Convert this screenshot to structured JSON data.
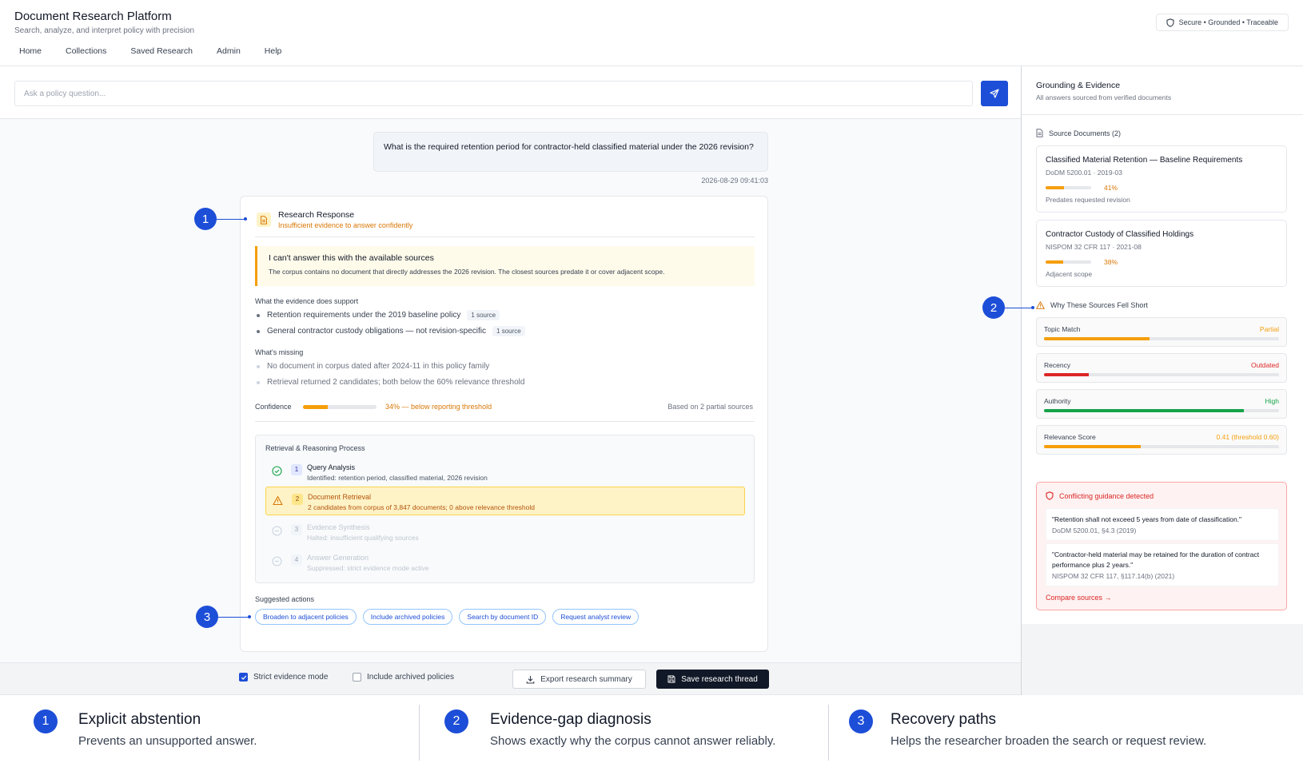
{
  "app": {
    "title": "Document Research Platform",
    "subtitle": "Search, analyze, and interpret policy with precision",
    "badge": "Secure • Grounded • Traceable"
  },
  "nav": [
    "Home",
    "Collections",
    "Saved Research",
    "Admin",
    "Help"
  ],
  "search": {
    "placeholder": "Ask a policy question...",
    "value": ""
  },
  "question": {
    "text": "What is the required retention period for contractor-held classified material under the 2026 revision?",
    "timestamp": "2026-08-29 09:41:03"
  },
  "response": {
    "title": "Research Response",
    "status": "Insufficient evidence to answer confidently",
    "abstain_title": "I can't answer this with the available sources",
    "abstain_body": "The corpus contains no document that directly addresses the 2026 revision. The closest sources predate it or cover adjacent scope.",
    "supports_label": "What the evidence does support",
    "supports": [
      {
        "text": "Retention requirements under the 2019 baseline policy",
        "chip": "1 source"
      },
      {
        "text": "General contractor custody obligations — not revision-specific",
        "chip": "1 source"
      }
    ],
    "missing_label": "What's missing",
    "missing": [
      "No document in corpus dated after 2024-11 in this policy family",
      "Retrieval returned 2 candidates; both below the 60% relevance threshold"
    ],
    "confidence_label": "Confidence",
    "confidence_value": 0.34,
    "confidence_text": "34% — below reporting threshold",
    "confidence_basis": "Based on 2 partial sources",
    "process_title": "Retrieval & Reasoning Process",
    "steps": [
      {
        "num": "1",
        "title": "Query Analysis",
        "desc": "Identified: retention period, classified material, 2026 revision",
        "state": "done"
      },
      {
        "num": "2",
        "title": "Document Retrieval",
        "desc": "2 candidates from corpus of 3,847 documents; 0 above relevance threshold",
        "state": "warn"
      },
      {
        "num": "3",
        "title": "Evidence Synthesis",
        "desc": "Halted: insufficient qualifying sources",
        "state": "dim"
      },
      {
        "num": "4",
        "title": "Answer Generation",
        "desc": "Suppressed: strict evidence mode active",
        "state": "dim"
      }
    ],
    "suggested_label": "Suggested actions",
    "suggested": [
      "Broaden to adjacent policies",
      "Include archived policies",
      "Search by document ID",
      "Request analyst review"
    ]
  },
  "footer": {
    "strict_mode": "Strict evidence mode",
    "strict_checked": true,
    "include_archived": "Include archived policies",
    "archived_checked": false,
    "export": "Export research summary",
    "save": "Save research thread"
  },
  "panel": {
    "title": "Grounding & Evidence",
    "subtitle": "All answers sourced from verified documents",
    "sources_label": "Source Documents (2)",
    "sources": [
      {
        "title": "Classified Material Retention — Baseline Requirements",
        "meta": "DoDM 5200.01 · 2019-03",
        "relevance": 0.41,
        "pct": "41%",
        "note": "Predates requested revision"
      },
      {
        "title": "Contractor Custody of Classified Holdings",
        "meta": "NISPOM 32 CFR 117 · 2021-08",
        "relevance": 0.38,
        "pct": "38%",
        "note": "Adjacent scope"
      }
    ],
    "why_label": "Why These Sources Fell Short",
    "metrics": [
      {
        "name": "Topic Match",
        "value": "Partial",
        "level": 0.45,
        "color": "#f59e0b"
      },
      {
        "name": "Recency",
        "value": "Outdated",
        "level": 0.19,
        "color": "#dc2626"
      },
      {
        "name": "Authority",
        "value": "High",
        "level": 0.85,
        "color": "#16a34a"
      },
      {
        "name": "Relevance Score",
        "value": "0.41 (threshold 0.60)",
        "level": 0.41,
        "color": "#f59e0b"
      }
    ],
    "conflict_title": "Conflicting guidance detected",
    "quotes": [
      {
        "text": "\"Retention shall not exceed 5 years from date of classification.\"",
        "source": "DoDM 5200.01, §4.3 (2019)"
      },
      {
        "text": "\"Contractor-held material may be retained for the duration of contract performance plus 2 years.\"",
        "source": "NISPOM 32 CFR 117, §117.14(b) (2021)"
      }
    ],
    "compare": "Compare sources →"
  },
  "callouts": [
    "1",
    "2",
    "3"
  ],
  "legend": [
    {
      "num": "1",
      "title": "Explicit abstention",
      "desc": "Prevents an unsupported answer."
    },
    {
      "num": "2",
      "title": "Evidence-gap diagnosis",
      "desc": "Shows exactly why the corpus cannot answer reliably."
    },
    {
      "num": "3",
      "title": "Recovery paths",
      "desc": "Helps the researcher broaden the search or request review."
    }
  ],
  "colors": {
    "accent": "#1d4ed8",
    "warning": "#f59e0b",
    "danger": "#dc2626",
    "success": "#16a34a"
  }
}
